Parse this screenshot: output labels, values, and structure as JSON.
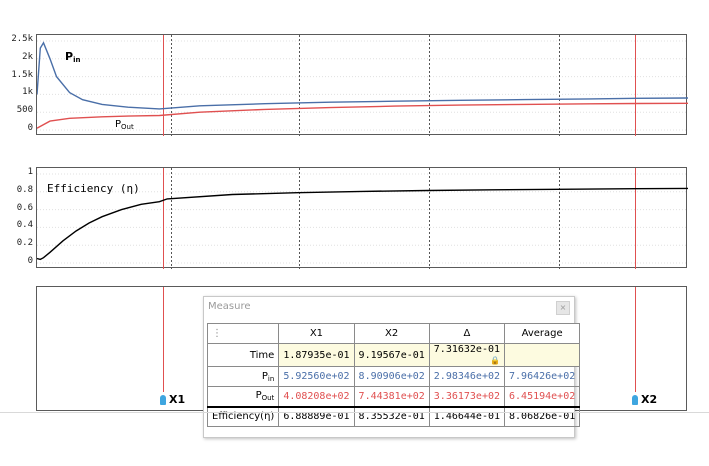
{
  "plot1": {
    "y_ticks": [
      "2.5k",
      "2k",
      "1.5k",
      "1k",
      "500",
      "0"
    ],
    "label_pin": "P",
    "label_pin_sub": "in",
    "label_pout": "P",
    "label_pout_sub": "Out"
  },
  "plot2": {
    "y_ticks": [
      "1",
      "0.8",
      "0.6",
      "0.4",
      "0.2",
      "0"
    ],
    "label": "Efficiency (η)"
  },
  "cursors": {
    "x1_label": "X1",
    "x2_label": "X2"
  },
  "colors": {
    "pin": "#4a6fa8",
    "pout": "#e05050",
    "efficiency": "#000000",
    "cursor": "#e05050",
    "pin_icon": "#3ea6e0"
  },
  "measure": {
    "title": "Measure",
    "menu_glyph": "⋮",
    "headers": [
      "X1",
      "X2",
      "Δ",
      "Average"
    ],
    "rows": [
      {
        "label": "Time",
        "values": [
          "1.87935e-01",
          "9.19567e-01",
          "7.31632e-01",
          ""
        ],
        "color": "black"
      },
      {
        "label": "P",
        "label_sub": "in",
        "values": [
          "5.92560e+02",
          "8.90906e+02",
          "2.98346e+02",
          "7.96426e+02"
        ],
        "color": "blue"
      },
      {
        "label": "P",
        "label_sub": "Out",
        "values": [
          "4.08208e+02",
          "7.44381e+02",
          "3.36173e+02",
          "6.45194e+02"
        ],
        "color": "red"
      },
      {
        "label": "Efficiency(η)",
        "values": [
          "6.88889e-01",
          "8.35532e-01",
          "1.46644e-01",
          "8.06826e-01"
        ],
        "color": "black"
      }
    ]
  },
  "chart_data": [
    {
      "type": "line",
      "ylim": [
        0,
        2500
      ],
      "series": [
        {
          "name": "P in",
          "x": [
            0.0,
            0.005,
            0.01,
            0.02,
            0.03,
            0.05,
            0.07,
            0.1,
            0.14,
            0.188,
            0.25,
            0.35,
            0.45,
            0.55,
            0.65,
            0.75,
            0.85,
            0.92,
            1.0
          ],
          "values": [
            1000,
            2300,
            2450,
            2000,
            1500,
            1050,
            850,
            720,
            640,
            593,
            680,
            740,
            780,
            810,
            835,
            855,
            875,
            891,
            900
          ]
        },
        {
          "name": "P out",
          "x": [
            0.0,
            0.02,
            0.05,
            0.1,
            0.15,
            0.188,
            0.25,
            0.35,
            0.45,
            0.55,
            0.65,
            0.75,
            0.85,
            0.92,
            1.0
          ],
          "values": [
            50,
            250,
            330,
            370,
            395,
            408,
            500,
            580,
            630,
            670,
            700,
            720,
            735,
            744,
            750
          ]
        }
      ]
    },
    {
      "type": "line",
      "ylim": [
        0,
        1
      ],
      "series": [
        {
          "name": "Efficiency (η)",
          "x": [
            0.0,
            0.005,
            0.01,
            0.02,
            0.04,
            0.06,
            0.08,
            0.1,
            0.13,
            0.16,
            0.188,
            0.2,
            0.3,
            0.4,
            0.5,
            0.6,
            0.7,
            0.8,
            0.92,
            1.0
          ],
          "values": [
            0.05,
            0.04,
            0.06,
            0.12,
            0.25,
            0.36,
            0.45,
            0.52,
            0.6,
            0.66,
            0.689,
            0.72,
            0.77,
            0.79,
            0.805,
            0.815,
            0.822,
            0.828,
            0.835,
            0.838
          ]
        }
      ]
    }
  ]
}
